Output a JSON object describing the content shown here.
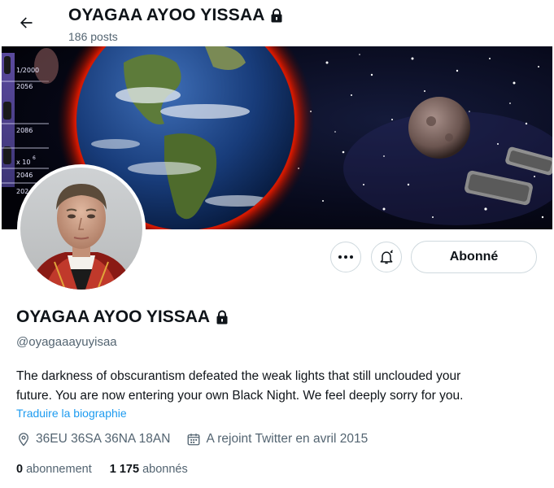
{
  "header": {
    "display_name": "OYAGAA AYOO YISSAA",
    "posts_count": "186 posts"
  },
  "banner": {
    "side_labels": [
      "1/2000",
      "2056",
      "2086",
      "x 10",
      "6",
      "2046",
      "202"
    ]
  },
  "actions": {
    "follow_label": "Abonné"
  },
  "profile": {
    "display_name": "OYAGAA AYOO YISSAA",
    "handle": "@oyagaaayuyisaa",
    "bio_line1": "The darkness of obscurantism defeated the weak lights that still unclouded your",
    "bio_line2": "future. You are now entering your own Black Night. We feel deeply sorry for you.",
    "translate_link": "Traduire la biographie",
    "location": "36EU 36SA 36NA 18AN",
    "joined": "A rejoint Twitter en avril 2015",
    "following_count": "0",
    "following_label": "abonnement",
    "followers_count": "1 175",
    "followers_label": "abonnés"
  },
  "colors": {
    "link": "#1d9bf0",
    "secondary_text": "#536471",
    "border": "#cfd9de"
  },
  "icons": [
    "back-arrow-icon",
    "lock-icon",
    "more-icon",
    "notification-bell-icon",
    "location-icon",
    "calendar-icon"
  ]
}
